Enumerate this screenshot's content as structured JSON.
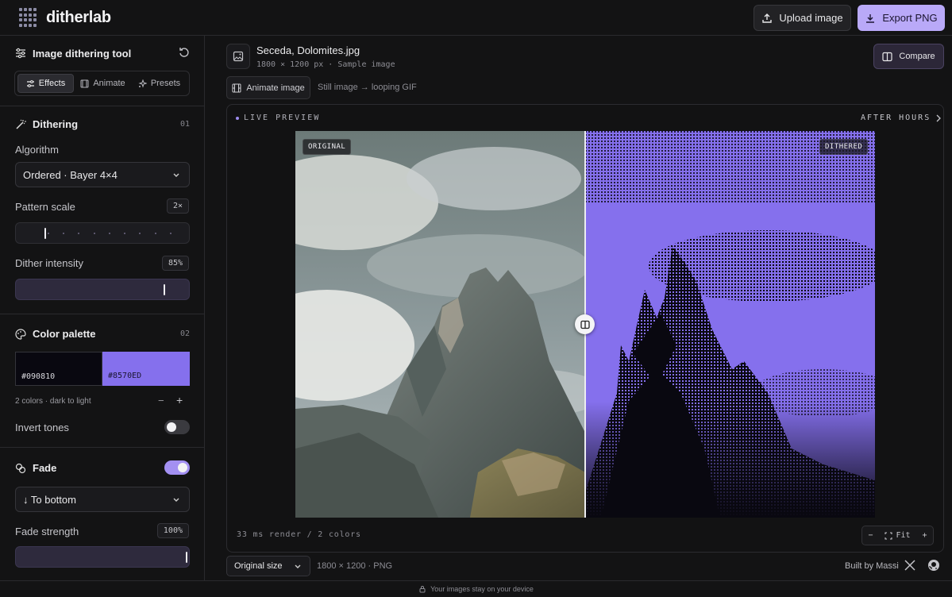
{
  "app": {
    "name": "ditherlab",
    "upload_label": "Upload image",
    "export_label": "Export PNG"
  },
  "sidebar": {
    "title": "Image dithering tool",
    "tabs": [
      {
        "label": "Effects",
        "icon": "sliders-icon",
        "active": true
      },
      {
        "label": "Animate",
        "icon": "film-icon",
        "active": false
      },
      {
        "label": "Presets",
        "icon": "sparkle-icon",
        "active": false
      }
    ],
    "dithering": {
      "title": "Dithering",
      "number": "01",
      "algorithm_label": "Algorithm",
      "algorithm_value": "Ordered · Bayer 4×4",
      "pattern_scale_label": "Pattern scale",
      "pattern_scale_value": "2×",
      "pattern_scale_level": 0.08,
      "intensity_label": "Dither intensity",
      "intensity_value": "85%",
      "intensity_level": 0.85
    },
    "palette": {
      "title": "Color palette",
      "number": "02",
      "colors": [
        "#090810",
        "#8570ED"
      ],
      "caption": "2 colors · dark to light",
      "minus": "−",
      "plus": "+",
      "invert_label": "Invert tones",
      "invert_on": false
    },
    "fade": {
      "title": "Fade",
      "enabled": true,
      "direction_value": "↓ To bottom",
      "strength_label": "Fade strength",
      "strength_value": "100%",
      "strength_level": 1.0
    }
  },
  "file": {
    "name": "Seceda, Dolomites.jpg",
    "meta": "1800 × 1200 px · Sample image",
    "compare_label": "Compare",
    "animate_label": "Animate image",
    "animate_hint": "Still image → looping GIF"
  },
  "preview": {
    "live_label": "LIVE PREVIEW",
    "after_label": "AFTER HOURS",
    "original_tag": "ORIGINAL",
    "dithered_tag": "DITHERED",
    "render_info": "33 ms render / 2 colors",
    "zoom_minus": "−",
    "zoom_fit": "Fit",
    "zoom_plus": "+"
  },
  "export": {
    "size_value": "Original size",
    "size_info": "1800 × 1200 · PNG",
    "built_by": "Built by Massi"
  },
  "footer": {
    "privacy": "Your images stay on your device"
  },
  "colors": {
    "accent": "#b9a9f8",
    "dither_dark": "#090810",
    "dither_light": "#8570ED"
  }
}
